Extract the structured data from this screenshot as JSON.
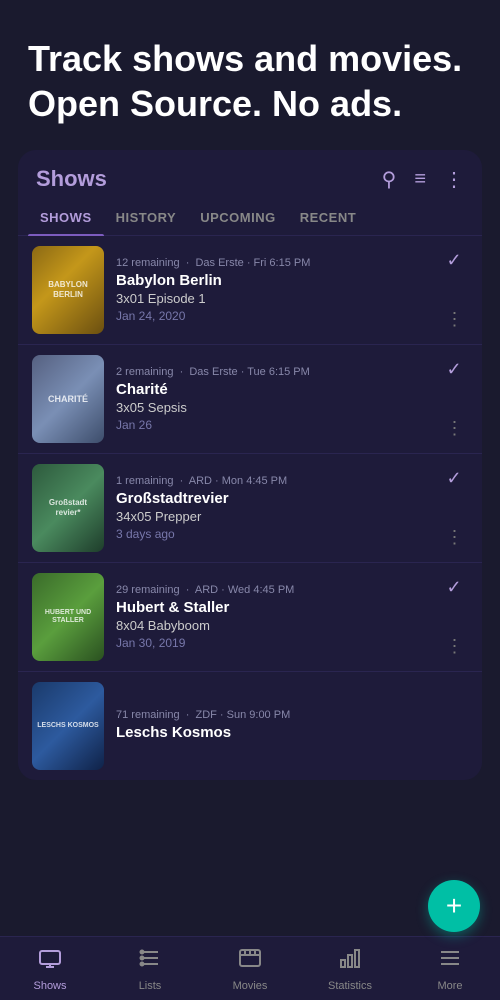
{
  "hero": {
    "title": "Track shows and movies. Open Source. No ads."
  },
  "card": {
    "title": "Shows",
    "tabs": [
      {
        "label": "SHOWS",
        "active": true
      },
      {
        "label": "HISTORY",
        "active": false
      },
      {
        "label": "UPCOMING",
        "active": false
      },
      {
        "label": "RECENT",
        "active": false
      }
    ]
  },
  "shows": [
    {
      "remaining": "12 remaining",
      "network": "Das Erste",
      "time": "Fri 6:15 PM",
      "name": "Babylon Berlin",
      "episode": "3x01 Episode 1",
      "date": "Jan 24, 2020",
      "poster_class": "poster-babylon",
      "poster_text": "BABYLON BERLIN"
    },
    {
      "remaining": "2 remaining",
      "network": "Das Erste",
      "time": "Tue 6:15 PM",
      "name": "Charité",
      "episode": "3x05 Sepsis",
      "date": "Jan 26",
      "poster_class": "poster-charite",
      "poster_text": "CHARITÉ"
    },
    {
      "remaining": "1 remaining",
      "network": "ARD",
      "time": "Mon 4:45 PM",
      "name": "Großstadtrevier",
      "episode": "34x05 Prepper",
      "date": "3 days ago",
      "poster_class": "poster-gross",
      "poster_text": "Großstadt revier"
    },
    {
      "remaining": "29 remaining",
      "network": "ARD",
      "time": "Wed 4:45 PM",
      "name": "Hubert & Staller",
      "episode": "8x04 Babyboom",
      "date": "Jan 30, 2019",
      "poster_class": "poster-hubert",
      "poster_text": "HUBERT UND STALLER"
    },
    {
      "remaining": "71 remaining",
      "network": "ZDF",
      "time": "Sun 9:00 PM",
      "name": "Leschs Kosmos",
      "episode": "",
      "date": "",
      "poster_class": "poster-leschs",
      "poster_text": "LESCHS KOSMOS"
    }
  ],
  "fab": {
    "label": "+"
  },
  "bottom_nav": [
    {
      "label": "Shows",
      "icon": "tv",
      "active": true
    },
    {
      "label": "Lists",
      "icon": "list",
      "active": false
    },
    {
      "label": "Movies",
      "icon": "movie",
      "active": false
    },
    {
      "label": "Statistics",
      "icon": "stats",
      "active": false
    },
    {
      "label": "More",
      "icon": "more",
      "active": false
    }
  ]
}
